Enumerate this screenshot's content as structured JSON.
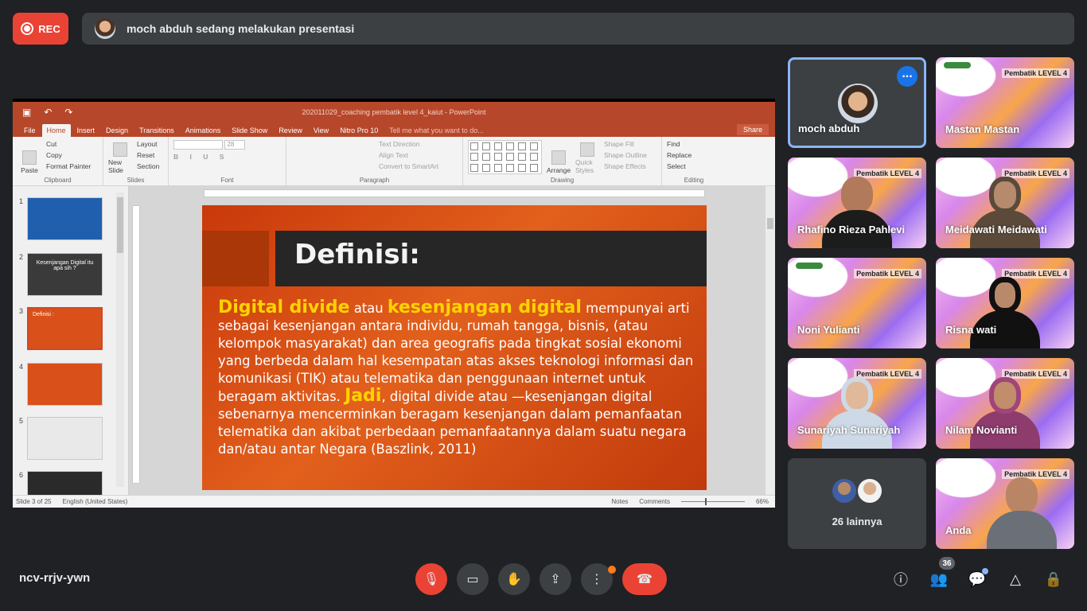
{
  "top": {
    "rec_label": "REC",
    "presenting_text": "moch abduh sedang melakukan presentasi"
  },
  "ppt": {
    "window_title": "202011029_coaching pembatik level 4_kaiut - PowerPoint",
    "tabs": [
      "File",
      "Home",
      "Insert",
      "Design",
      "Transitions",
      "Animations",
      "Slide Show",
      "Review",
      "View",
      "Nitro Pro 10"
    ],
    "active_tab": "Home",
    "tell_me": "Tell me what you want to do...",
    "share_label": "Share",
    "ribbon": {
      "paste": "Paste",
      "cut": "Cut",
      "copy": "Copy",
      "format_painter": "Format Painter",
      "clipboard": "Clipboard",
      "new_slide": "New Slide",
      "layout": "Layout",
      "reset": "Reset",
      "section": "Section",
      "slides": "Slides",
      "font_size": "28",
      "font": "Font",
      "text_direction": "Text Direction",
      "align_text": "Align Text",
      "convert_smartart": "Convert to SmartArt",
      "paragraph": "Paragraph",
      "arrange": "Arrange",
      "quick_styles": "Quick Styles",
      "shape_fill": "Shape Fill",
      "shape_outline": "Shape Outline",
      "shape_effects": "Shape Effects",
      "drawing": "Drawing",
      "find": "Find",
      "replace": "Replace",
      "select": "Select",
      "editing": "Editing"
    },
    "thumbnails": [
      {
        "num": "1",
        "color": "#1f5fae"
      },
      {
        "num": "2",
        "color": "#3a3a3a",
        "title": "Kesenjangan Digital itu apa sih ?"
      },
      {
        "num": "3",
        "color": "#d9501a",
        "title": "Definisi :"
      },
      {
        "num": "4",
        "color": "#d9501a"
      },
      {
        "num": "5",
        "color": "#e9e9e9"
      },
      {
        "num": "6",
        "color": "#2a2a2a"
      }
    ],
    "slide": {
      "title": "Definisi:",
      "hl1": "Digital divide",
      "t1": " atau ",
      "hl2": "kesenjangan digital",
      "t2": " mempunyai arti sebagai kesenjangan antara individu, rumah tangga, bisnis, (atau kelompok masyarakat) dan area geografis pada tingkat sosial ekonomi yang berbeda dalam hal kesempatan atas akses teknologi informasi dan komunikasi (TIK) atau telematika dan penggunaan internet untuk beragam aktivitas. ",
      "hl3": "Jadi",
      "t3": ", digital divide atau —kesenjangan digital sebenarnya mencerminkan beragam kesenjangan dalam pemanfaatan telematika dan akibat perbedaan pemanfaatannya dalam suatu negara dan/atau antar Negara (Baszlink, 2011)"
    },
    "status": {
      "slide_of": "Slide 3 of 25",
      "language": "English (United States)",
      "notes": "Notes",
      "comments": "Comments",
      "zoom": "66%"
    }
  },
  "tiles": [
    {
      "name": "moch abduh",
      "type": "avatar"
    },
    {
      "name": "Mastan Mastan",
      "type": "banner"
    },
    {
      "name": "Rhafino Rieza Pahlevi",
      "type": "person",
      "head": "#b17a5a",
      "body": "#1c1c1c"
    },
    {
      "name": "Meidawati Meidawati",
      "type": "person",
      "head": "#b58a6d",
      "body": "#2b2b2b",
      "hijab": "#5b4a3a"
    },
    {
      "name": "Noni Yulianti",
      "type": "banner"
    },
    {
      "name": "Risna wati",
      "type": "person",
      "head": "#b98a6a",
      "body": "#111111",
      "hijab": "#111111"
    },
    {
      "name": "Sunariyah Sunariyah",
      "type": "person",
      "head": "#e0b89a",
      "body": "#dfe6ee",
      "hijab": "#cdd9e6"
    },
    {
      "name": "Nilam Novianti",
      "type": "person",
      "head": "#c18d6b",
      "body": "#8e3b6d",
      "hijab": "#a0447b"
    },
    {
      "name": "26 lainnya",
      "type": "others"
    },
    {
      "name": "Anda",
      "type": "person",
      "head": "#b98564",
      "body": "#6a6f78"
    }
  ],
  "banner_text": "Pembatik LEVEL 4",
  "bottom": {
    "meeting_code": "ncv-rrjv-ywn",
    "participants_count": "36"
  },
  "icons": {
    "mic_off": "🎙",
    "camera": "▭",
    "hand": "✋",
    "present": "⇪",
    "more": "⋮",
    "hangup": "☎",
    "info": "ⓘ",
    "people": "👥",
    "chat": "💬",
    "activities": "△",
    "lock": "🔒"
  }
}
